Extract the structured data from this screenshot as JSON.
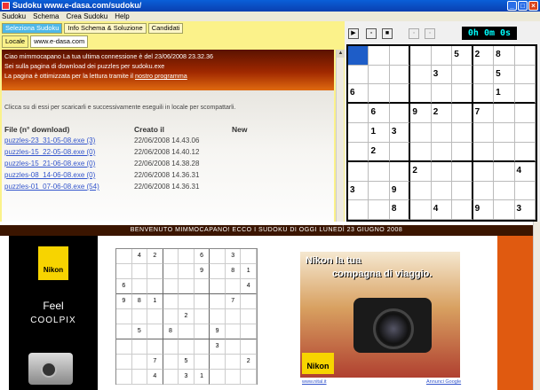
{
  "window": {
    "title": "Sudoku www.e-dasa.com/sudoku/"
  },
  "menu": [
    "Sudoku",
    "Schema",
    "Crea Sudoku",
    "Help"
  ],
  "tabs_top": [
    "Seleziona Sudoku",
    "Info Schema & Soluzione",
    "Candidati"
  ],
  "tabs_sub": [
    "Locale",
    "www.e-dasa.com"
  ],
  "browser": {
    "line1": "Ciao mimmocapano La tua ultima connessione è del 23/06/2008 23.32.36",
    "line2": "Sei sulla pagina di download dei puzzles per sudoku.exe",
    "line3_prefix": "La pagina è ottimizzata per la lettura tramite il ",
    "line3_link": "nostro programma",
    "instruction": "Clicca su di essi per scaricarli e successivamente eseguili in locale per scompattarli.",
    "table_headers": [
      "File (n° download)",
      "Creato il",
      "New"
    ],
    "files": [
      {
        "name": "puzzles-23_31-05-08.exe (3)",
        "created": "22/06/2008 14.43.06"
      },
      {
        "name": "puzzles-15_22-05-08.exe (0)",
        "created": "22/06/2008 14.40.12"
      },
      {
        "name": "puzzles-15_21-06-08.exe (0)",
        "created": "22/06/2008 14.38.28"
      },
      {
        "name": "puzzles-08_14-06-08.exe (0)",
        "created": "22/06/2008 14.36.31"
      },
      {
        "name": "puzzles-01_07-06-08.exe (54)",
        "created": "22/06/2008 14.36.31"
      }
    ]
  },
  "timer": "0h 0m 0s",
  "sudoku": [
    [
      "",
      "",
      "",
      "",
      "",
      "5",
      "2",
      "8",
      ""
    ],
    [
      "",
      "",
      "",
      "",
      "3",
      "",
      "",
      "5",
      ""
    ],
    [
      "6",
      "",
      "",
      "",
      "",
      "",
      "",
      "1",
      ""
    ],
    [
      "",
      "6",
      "",
      "9",
      "2",
      "",
      "7",
      "",
      ""
    ],
    [
      "",
      "1",
      "3",
      "",
      "",
      "",
      "",
      "",
      ""
    ],
    [
      "",
      "2",
      "",
      "",
      "",
      "",
      "",
      "",
      ""
    ],
    [
      "",
      "",
      "",
      "2",
      "",
      "",
      "",
      "",
      "4"
    ],
    [
      "3",
      "",
      "9",
      "",
      "",
      "",
      "",
      "",
      ""
    ],
    [
      "",
      "",
      "8",
      "",
      "4",
      "",
      "9",
      "",
      "3"
    ]
  ],
  "bottom": {
    "banner": "BENVENUTO MIMMOCAPANO! ECCO I SUDOKU DI OGGI LUNEDÌ 23 GIUGNO 2008",
    "left_ad": {
      "logo": "Nikon",
      "feel": "Feel",
      "brand": "COOLPIX"
    },
    "sudoku2": [
      [
        "",
        "4",
        "2",
        "",
        "",
        "6",
        "",
        "3",
        ""
      ],
      [
        "",
        "",
        "",
        "",
        "",
        "9",
        "",
        "8",
        "1"
      ],
      [
        "6",
        "",
        "",
        "",
        "",
        "",
        "",
        "",
        "4"
      ],
      [
        "9",
        "8",
        "1",
        "",
        "",
        "",
        "",
        "7",
        ""
      ],
      [
        "",
        "",
        "",
        "",
        "2",
        "",
        "",
        "",
        ""
      ],
      [
        "",
        "5",
        "",
        "8",
        "",
        "",
        "9",
        "",
        ""
      ],
      [
        "",
        "",
        "",
        "",
        "",
        "",
        "3",
        "",
        ""
      ],
      [
        "",
        "",
        "7",
        "",
        "5",
        "",
        "",
        "",
        "2"
      ],
      [
        "",
        "",
        "4",
        "",
        "3",
        "1",
        "",
        "",
        ""
      ]
    ],
    "ad": {
      "line1": "Nikon la tua",
      "line2": "compagna di viaggio.",
      "logo": "Nikon",
      "link": "www.nital.it",
      "google": "Annunci Google"
    }
  }
}
